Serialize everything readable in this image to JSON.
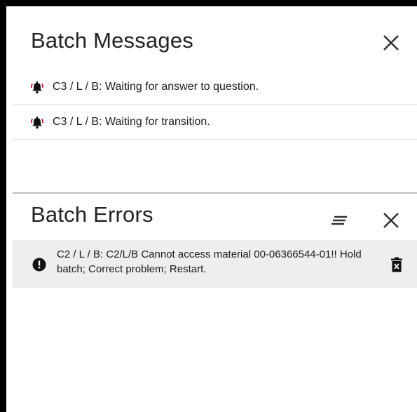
{
  "messages_panel": {
    "title": "Batch Messages",
    "close_icon": "close-icon",
    "items": [
      {
        "icon": "bell-ringing-icon",
        "text": "C3 / L / B: Waiting for answer to question."
      },
      {
        "icon": "bell-ringing-icon",
        "text": "C3 / L / B: Waiting for transition."
      }
    ]
  },
  "errors_panel": {
    "title": "Batch Errors",
    "filter_icon": "filter-lines-icon",
    "close_icon": "close-icon",
    "items": [
      {
        "icon": "error-icon",
        "text": "C2 / L / B: C2/L/B Cannot access material 00-06366544-01!! Hold batch; Correct problem; Restart.",
        "action_icon": "trash-icon"
      }
    ]
  },
  "colors": {
    "frame": "#000000",
    "title_text": "#222222",
    "row_text": "#1a1a1a",
    "error_row_bg": "#eeeeee",
    "divider": "#bdbdbd"
  }
}
